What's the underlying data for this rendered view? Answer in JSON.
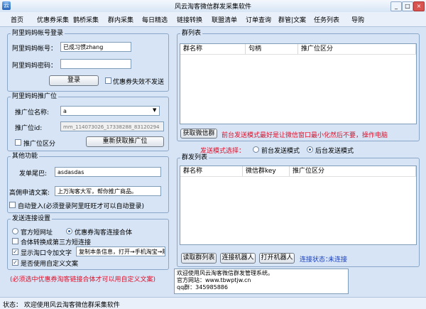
{
  "window": {
    "title": "风云淘客微信群发采集软件"
  },
  "menu": [
    "首页",
    "优惠券采集",
    "鹊桥采集",
    "群内采集",
    "每日精选",
    "链接转换",
    "联盟清单",
    "订单查询",
    "群管|文案",
    "任务列表",
    "导购"
  ],
  "login": {
    "legend": "阿里妈妈帐号登录",
    "account_label": "阿里妈妈帐号：",
    "account_value": "已成习惯zhang",
    "password_label": "阿里妈妈密码：",
    "password_value": "",
    "login_button": "登录",
    "coupon_check_label": "优惠券失效不发送"
  },
  "promo": {
    "legend": "阿里妈妈推广位",
    "name_label": "推广位名称:",
    "name_value": "a",
    "id_label": "推广位id:",
    "id_value": "mm_114073026_17338288_83120294",
    "split_label": "推广位区分",
    "refresh_button": "重新获取推广位"
  },
  "other": {
    "legend": "其他功能",
    "tail_label": "发单尾巴:",
    "tail_value": "asdasdas",
    "copy_label": "高佣申请文案:",
    "copy_value": "上万淘客大军，帮你推广商品。",
    "auto_login_label": "自动登入(必须登录阿里旺旺才可以自动登录)"
  },
  "link": {
    "legend": "发送连接设置",
    "radio_official": "官方短网址",
    "radio_coupon": "优惠券淘客连接合体",
    "check_third": "合体转换成第三方短连接",
    "check_tkl": "显示淘口令加文字",
    "tkl_value": "复制本条信息，打开→手机淘宝→随",
    "check_custom": "是否使用自定义文案",
    "warning": "(必须选中优惠券淘客链接合体才可以用自定义文案)"
  },
  "groups": {
    "legend": "群列表",
    "columns": [
      "群名称",
      "句柄",
      "推广位区分"
    ],
    "fetch_button": "获取微信群",
    "hint": "前台发送模式最好是让微信窗口最小化然后不要，操作电脑"
  },
  "send_mode": {
    "label": "发送模式选择：",
    "front": "前台发送模式",
    "back": "后台发送模式"
  },
  "sendlist": {
    "legend": "群发列表",
    "columns": [
      "群名称",
      "微信群key",
      "推广位区分"
    ],
    "read_button": "读取群列表",
    "connect_button": "连接机器人",
    "open_button": "打开机器人",
    "conn_label": "连接状态：",
    "conn_value": "未连接"
  },
  "log": [
    "欢迎使用风云淘客微信群发管理系统。",
    "官方网站：www.tbwptjw.cn",
    "qq群：345985886"
  ],
  "statusbar": {
    "text": "状态： 欢迎使用风云淘客微信群采集软件"
  },
  "colors": {
    "accent": "#1a3fbf",
    "warning": "#e0102a",
    "panel": "#d6e4f5"
  }
}
